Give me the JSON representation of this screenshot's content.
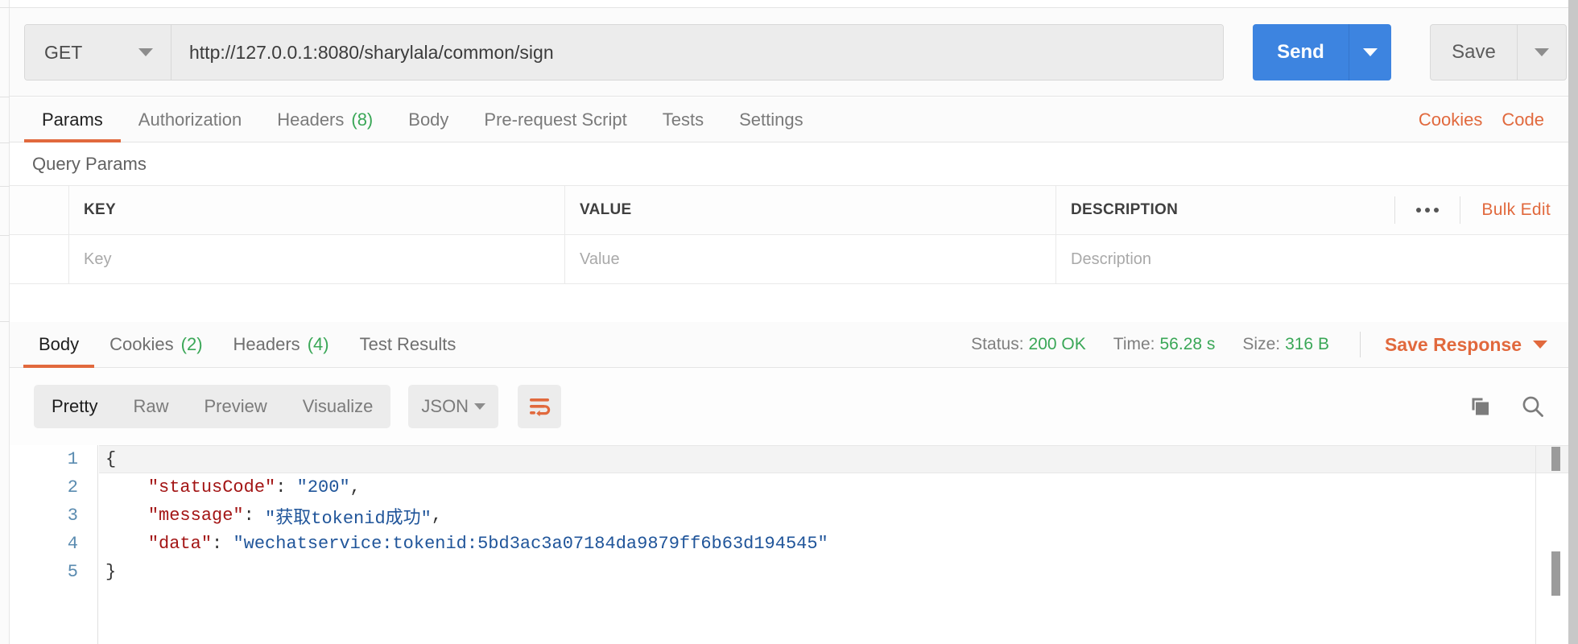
{
  "request": {
    "method": "GET",
    "method_caret_icon": "chevron-down-icon",
    "url": "http://127.0.0.1:8080/sharylala/common/sign",
    "url_placeholder": "Enter request URL",
    "send_label": "Send",
    "send_caret_icon": "chevron-down-icon",
    "save_label": "Save",
    "save_caret_icon": "chevron-down-icon",
    "accent_blue": "#3d84e0"
  },
  "request_tabs": {
    "items": [
      {
        "label": "Params",
        "count": "",
        "active": true
      },
      {
        "label": "Authorization",
        "count": "",
        "active": false
      },
      {
        "label": "Headers",
        "count": "(8)",
        "active": false
      },
      {
        "label": "Body",
        "count": "",
        "active": false
      },
      {
        "label": "Pre-request Script",
        "count": "",
        "active": false
      },
      {
        "label": "Tests",
        "count": "",
        "active": false
      },
      {
        "label": "Settings",
        "count": "",
        "active": false
      }
    ],
    "cookies_label": "Cookies",
    "code_label": "Code",
    "accent_orange": "#e1693d",
    "count_green": "#3aa757"
  },
  "query_params": {
    "title": "Query Params",
    "columns": [
      "KEY",
      "VALUE",
      "DESCRIPTION"
    ],
    "rows": [
      {
        "key_placeholder": "Key",
        "value_placeholder": "Value",
        "description_placeholder": "Description"
      }
    ],
    "more_icon": "ellipsis-icon",
    "bulk_edit_label": "Bulk Edit"
  },
  "response_tabs": {
    "items": [
      {
        "label": "Body",
        "count": "",
        "active": true
      },
      {
        "label": "Cookies",
        "count": "(2)",
        "active": false
      },
      {
        "label": "Headers",
        "count": "(4)",
        "active": false
      },
      {
        "label": "Test Results",
        "count": "",
        "active": false
      }
    ],
    "status_label": "Status:",
    "status_value": "200 OK",
    "time_label": "Time:",
    "time_value": "56.28 s",
    "size_label": "Size:",
    "size_value": "316 B",
    "save_response_label": "Save Response",
    "save_response_caret_icon": "chevron-down-icon"
  },
  "body_toolbar": {
    "formats": [
      {
        "label": "Pretty",
        "active": true
      },
      {
        "label": "Raw",
        "active": false
      },
      {
        "label": "Preview",
        "active": false
      },
      {
        "label": "Visualize",
        "active": false
      }
    ],
    "language": "JSON",
    "language_caret_icon": "chevron-down-icon",
    "wrap_icon": "word-wrap-icon",
    "copy_icon": "copy-icon",
    "search_icon": "search-icon"
  },
  "code": {
    "line_numbers": [
      "1",
      "2",
      "3",
      "4",
      "5"
    ],
    "lines": [
      {
        "indent": "",
        "tokens": [
          {
            "t": "p",
            "v": "{"
          }
        ]
      },
      {
        "indent": "    ",
        "tokens": [
          {
            "t": "k",
            "v": "\"statusCode\""
          },
          {
            "t": "p",
            "v": ": "
          },
          {
            "t": "s",
            "v": "\"200\""
          },
          {
            "t": "p",
            "v": ","
          }
        ]
      },
      {
        "indent": "    ",
        "tokens": [
          {
            "t": "k",
            "v": "\"message\""
          },
          {
            "t": "p",
            "v": ": "
          },
          {
            "t": "s",
            "v": "\"获取tokenid成功\""
          },
          {
            "t": "p",
            "v": ","
          }
        ]
      },
      {
        "indent": "    ",
        "tokens": [
          {
            "t": "k",
            "v": "\"data\""
          },
          {
            "t": "p",
            "v": ": "
          },
          {
            "t": "s",
            "v": "\"wechatservice:tokenid:5bd3ac3a07184da9879ff6b63d194545\""
          }
        ]
      },
      {
        "indent": "",
        "tokens": [
          {
            "t": "p",
            "v": "}"
          }
        ]
      }
    ],
    "key_color": "#a31515",
    "string_color": "#20559a",
    "gutter_color": "#5a8bb0"
  }
}
